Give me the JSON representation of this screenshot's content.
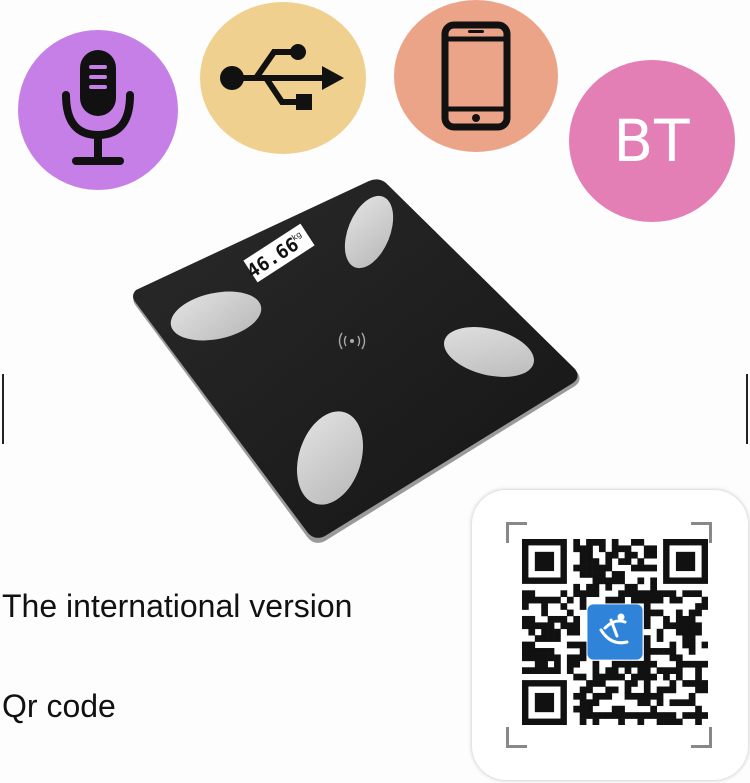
{
  "features": {
    "mic": {
      "icon": "microphone-icon",
      "color": "#c57fe6"
    },
    "usb": {
      "icon": "usb-icon",
      "color": "#f0d08e"
    },
    "phone": {
      "icon": "smartphone-icon",
      "color": "#eba487"
    },
    "bt": {
      "label": "BT",
      "color": "#e47fb6"
    }
  },
  "scale_display": {
    "value": "46.66",
    "unit": "kg"
  },
  "captions": {
    "version": "The international version",
    "qr": "Qr code"
  },
  "colors": {
    "scale_body": "#1c1c1c",
    "pad": "#cfcfcf",
    "qr_logo": "#2f84d9"
  }
}
